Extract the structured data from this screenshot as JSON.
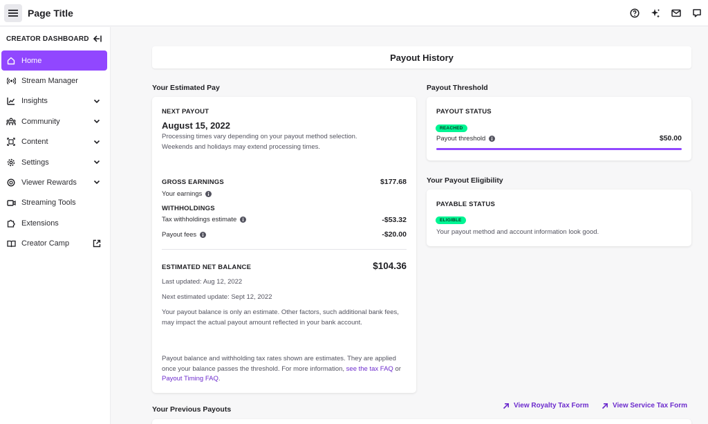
{
  "header": {
    "title": "Page Title",
    "icons": [
      "help-icon",
      "sparkle-icon",
      "mail-icon",
      "chat-icon"
    ]
  },
  "sidebar": {
    "heading": "CREATOR DASHBOARD",
    "items": [
      {
        "label": "Home",
        "icon": "home-icon",
        "active": true
      },
      {
        "label": "Stream Manager",
        "icon": "broadcast-icon"
      },
      {
        "label": "Insights",
        "icon": "chart-icon",
        "expandable": true
      },
      {
        "label": "Community",
        "icon": "community-icon",
        "expandable": true
      },
      {
        "label": "Content",
        "icon": "content-icon",
        "expandable": true
      },
      {
        "label": "Settings",
        "icon": "gear-icon",
        "expandable": true
      },
      {
        "label": "Viewer Rewards",
        "icon": "rewards-icon",
        "expandable": true
      },
      {
        "label": "Streaming Tools",
        "icon": "camera-icon"
      },
      {
        "label": "Extensions",
        "icon": "puzzle-icon"
      },
      {
        "label": "Creator Camp",
        "icon": "book-icon",
        "external": true
      }
    ]
  },
  "main": {
    "title": "Payout History",
    "estimated_pay": {
      "label": "Your Estimated Pay",
      "next_payout_caption": "NEXT PAYOUT",
      "next_payout_date": "August 15, 2022",
      "processing_note": "Processing times vary depending on your payout method selection. Weekends and holidays may extend processing times.",
      "gross_caption": "GROSS EARNINGS",
      "gross_amount": "$177.68",
      "your_earnings": "Your earnings",
      "withholdings_caption": "WITHHOLDINGS",
      "tax_label": "Tax withholdings estimate",
      "tax_amount": "-$53.32",
      "fees_label": "Payout fees",
      "fees_amount": "-$20.00",
      "net_caption": "ESTIMATED NET BALANCE",
      "net_amount": "$104.36",
      "last_updated": "Last updated: Aug 12, 2022",
      "next_update": "Next estimated update: Sept 12, 2022",
      "estimate_note": "Your payout balance is only an estimate. Other factors, such additional bank fees, may impact the actual payout amount reflected in your bank account.",
      "footer_text": "Payout balance and withholding tax rates shown are estimates. They are applied once your balance passes the threshold. For more information,",
      "footer_link_1": "see the tax FAQ",
      "footer_or": "or",
      "footer_link_2": "Payout Timing FAQ",
      "footer_end": "."
    },
    "threshold": {
      "label": "Payout Threshold",
      "status_caption": "PAYOUT STATUS",
      "badge": "REACHED",
      "threshold_label": "Payout threshold",
      "threshold_amount": "$50.00",
      "progress": 1.0
    },
    "eligibility": {
      "label": "Your Payout Eligibility",
      "status_caption": "PAYABLE STATUS",
      "badge": "ELIGIBLE",
      "note": "Your payout method and account information look good."
    },
    "previous": {
      "label": "Your Previous Payouts",
      "royalty_link": "View Royalty Tax Form",
      "service_link": "View Service Tax Form"
    }
  },
  "colors": {
    "accent": "#9147ff",
    "badge_green": "#00f593",
    "link": "#6d2ccd"
  }
}
